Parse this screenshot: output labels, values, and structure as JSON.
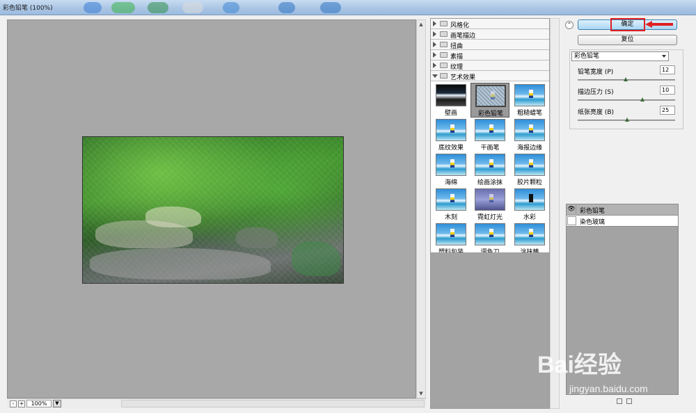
{
  "window": {
    "title": "彩色铅笔 (100%)"
  },
  "preview": {
    "zoom": "100%",
    "zoom_out": "-",
    "zoom_in": "+"
  },
  "gallery": {
    "categories": [
      {
        "label": "风格化",
        "open": false
      },
      {
        "label": "画笔描边",
        "open": false
      },
      {
        "label": "扭曲",
        "open": false
      },
      {
        "label": "素描",
        "open": false
      },
      {
        "label": "纹理",
        "open": false
      },
      {
        "label": "艺术效果",
        "open": true
      }
    ],
    "filters": [
      "壁画",
      "彩色铅笔",
      "粗糙蜡笔",
      "底纹效果",
      "干画笔",
      "海报边缘",
      "海绵",
      "绘画涂抹",
      "胶片颗粒",
      "木刻",
      "霓虹灯光",
      "水彩",
      "塑料包装",
      "调色刀",
      "涂抹棒"
    ],
    "selected": "彩色铅笔"
  },
  "actions": {
    "ok_label": "确定",
    "reset_label": "复位"
  },
  "settings": {
    "filter_select": "彩色铅笔",
    "params": [
      {
        "label": "铅笔宽度 (P)",
        "value": "12",
        "level": 0.5
      },
      {
        "label": "描边压力 (S)",
        "value": "10",
        "level": 0.67
      },
      {
        "label": "纸张亮度 (B)",
        "value": "25",
        "level": 0.5
      }
    ]
  },
  "layers": [
    {
      "name": "彩色铅笔",
      "visible": true,
      "active": true
    },
    {
      "name": "染色玻璃",
      "visible": false,
      "active": false
    }
  ],
  "watermark": {
    "brand": "Bai经验",
    "url": "jingyan.baidu.com"
  },
  "colors": {
    "highlight": "#e02020",
    "preview_bg": "#a8a8a8"
  }
}
